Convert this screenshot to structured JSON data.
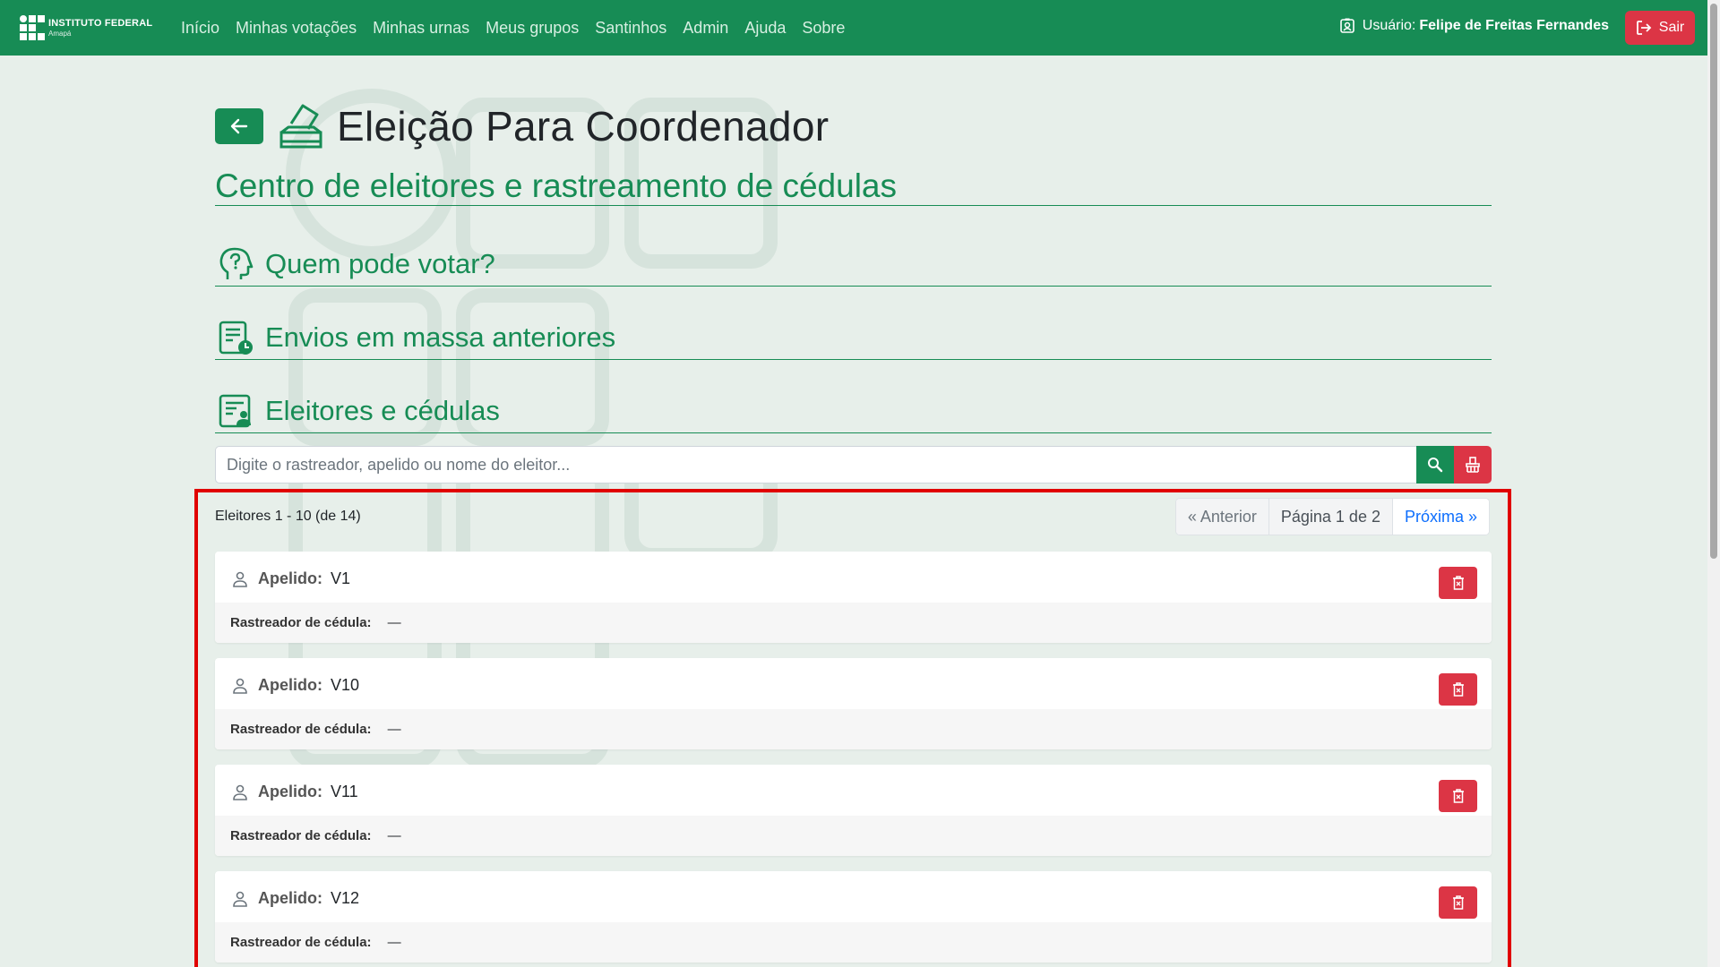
{
  "navbar": {
    "brand_line1": "INSTITUTO FEDERAL",
    "brand_line2": "Amapá",
    "links": [
      "Início",
      "Minhas votações",
      "Minhas urnas",
      "Meus grupos",
      "Santinhos",
      "Admin",
      "Ajuda",
      "Sobre"
    ],
    "user_label": "Usuário:",
    "user_name": "Felipe de Freitas Fernandes",
    "logout_label": "Sair"
  },
  "page": {
    "title": "Eleição Para Coordenador",
    "subtitle": "Centro de eleitores e rastreamento de cédulas",
    "sections": [
      "Quem pode votar?",
      "Envios em massa anteriores",
      "Eleitores e cédulas"
    ]
  },
  "search": {
    "placeholder": "Digite o rastreador, apelido ou nome do eleitor..."
  },
  "list": {
    "count_text": "Eleitores 1 - 10 (de 14)",
    "pager": {
      "prev": "« Anterior",
      "info": "Página 1 de 2",
      "next": "Próxima »"
    },
    "nickname_label": "Apelido:",
    "tracker_label": "Rastreador de cédula:",
    "voters": [
      {
        "nickname": "V1",
        "tracker": "—"
      },
      {
        "nickname": "V10",
        "tracker": "—"
      },
      {
        "nickname": "V11",
        "tracker": "—"
      },
      {
        "nickname": "V12",
        "tracker": "—"
      }
    ]
  },
  "colors": {
    "primary": "#178c55",
    "danger": "#dc3545",
    "background": "#e7efea",
    "highlight": "#e00000"
  }
}
